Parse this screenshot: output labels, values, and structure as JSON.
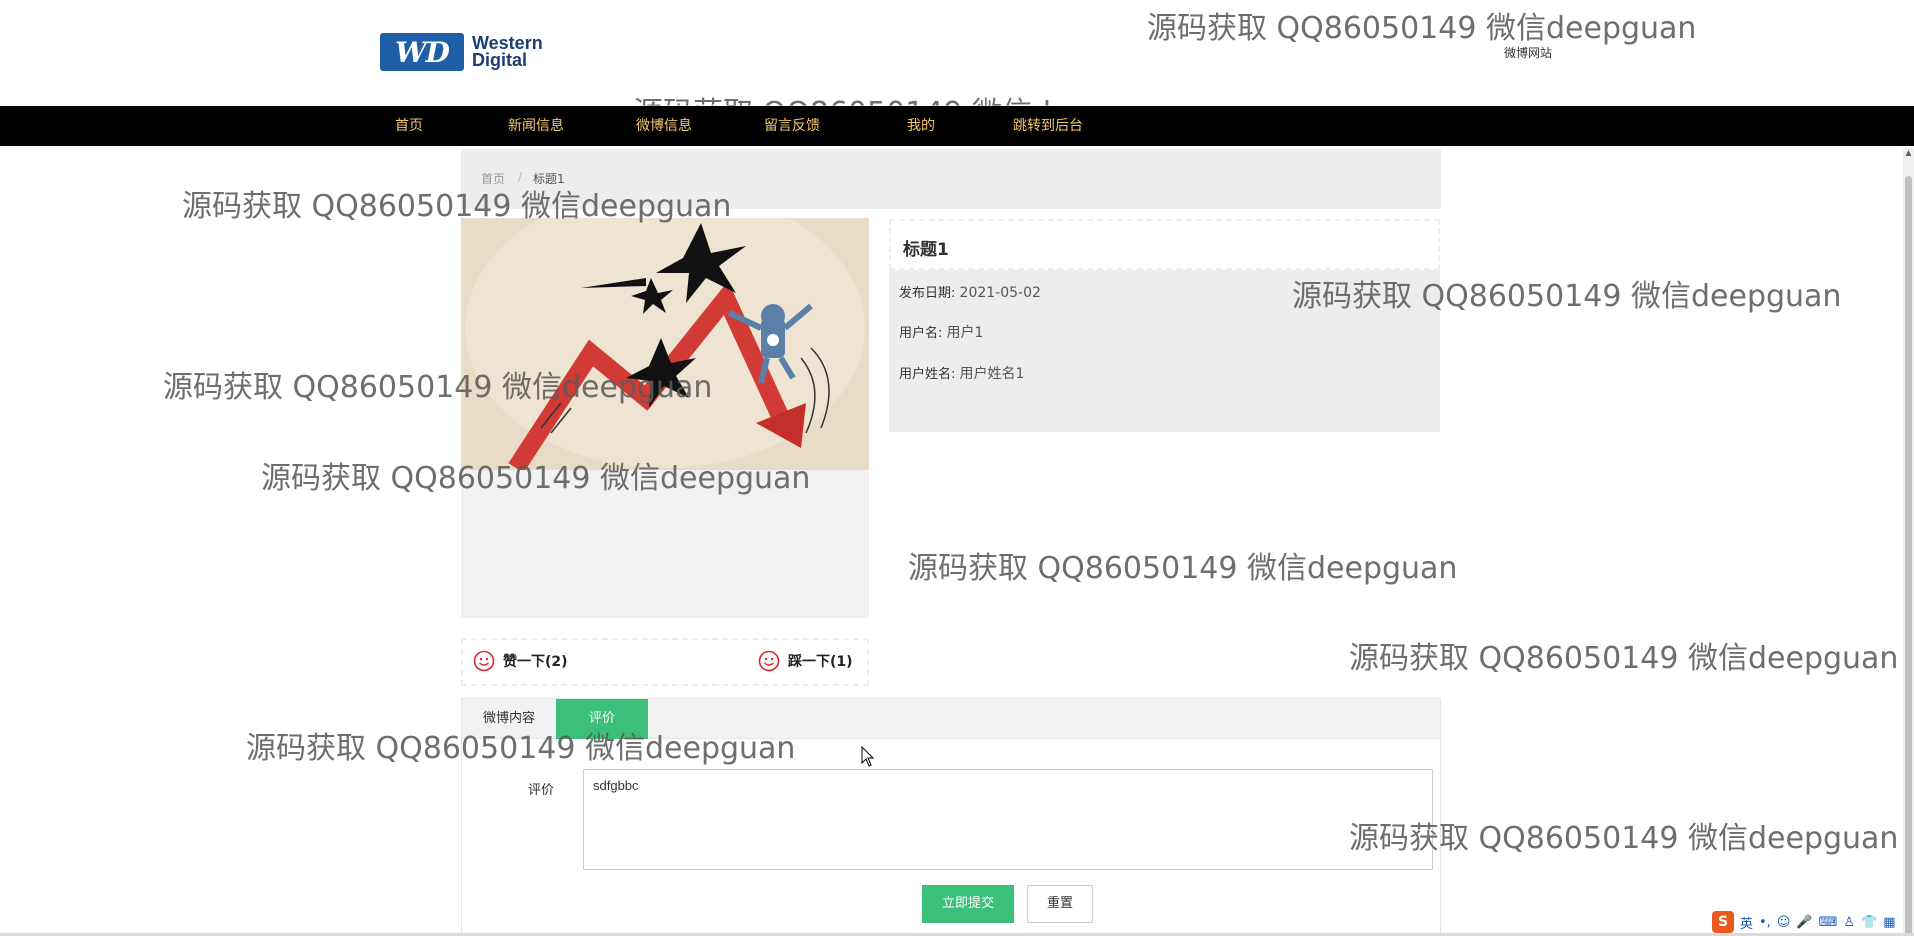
{
  "header": {
    "logo": {
      "mark": "WD",
      "line1": "Western",
      "line2": "Digital"
    },
    "site_link": "微博网站"
  },
  "nav": {
    "items": [
      {
        "label": "首页"
      },
      {
        "label": "新闻信息"
      },
      {
        "label": "微博信息"
      },
      {
        "label": "留言反馈"
      },
      {
        "label": "我的"
      },
      {
        "label": "跳转到后台"
      }
    ]
  },
  "breadcrumb": {
    "home": "首页",
    "separator": "/",
    "current": "标题1"
  },
  "detail": {
    "title": "标题1",
    "publish_date_label": "发布日期:",
    "publish_date": "2021-05-02",
    "username_label": "用户名:",
    "username": "用户1",
    "realname_label": "用户姓名:",
    "realname": "用户姓名1"
  },
  "votes": {
    "like_label": "赞一下(2)",
    "dislike_label": "踩一下(1)"
  },
  "tabs": {
    "items": [
      {
        "label": "微博内容"
      },
      {
        "label": "评价"
      }
    ]
  },
  "comment_form": {
    "label": "评价",
    "value": "sdfgbbc",
    "submit_label": "立即提交",
    "reset_label": "重置"
  },
  "watermark_text": "源码获取 QQ86050149 微信deepguan",
  "ime": {
    "lang": "英"
  },
  "colors": {
    "nav_bg": "#000000",
    "nav_text": "#f2c66d",
    "accent_green": "#3cbf79",
    "panel_bg": "#ededed",
    "smile_red": "#e0252b"
  }
}
